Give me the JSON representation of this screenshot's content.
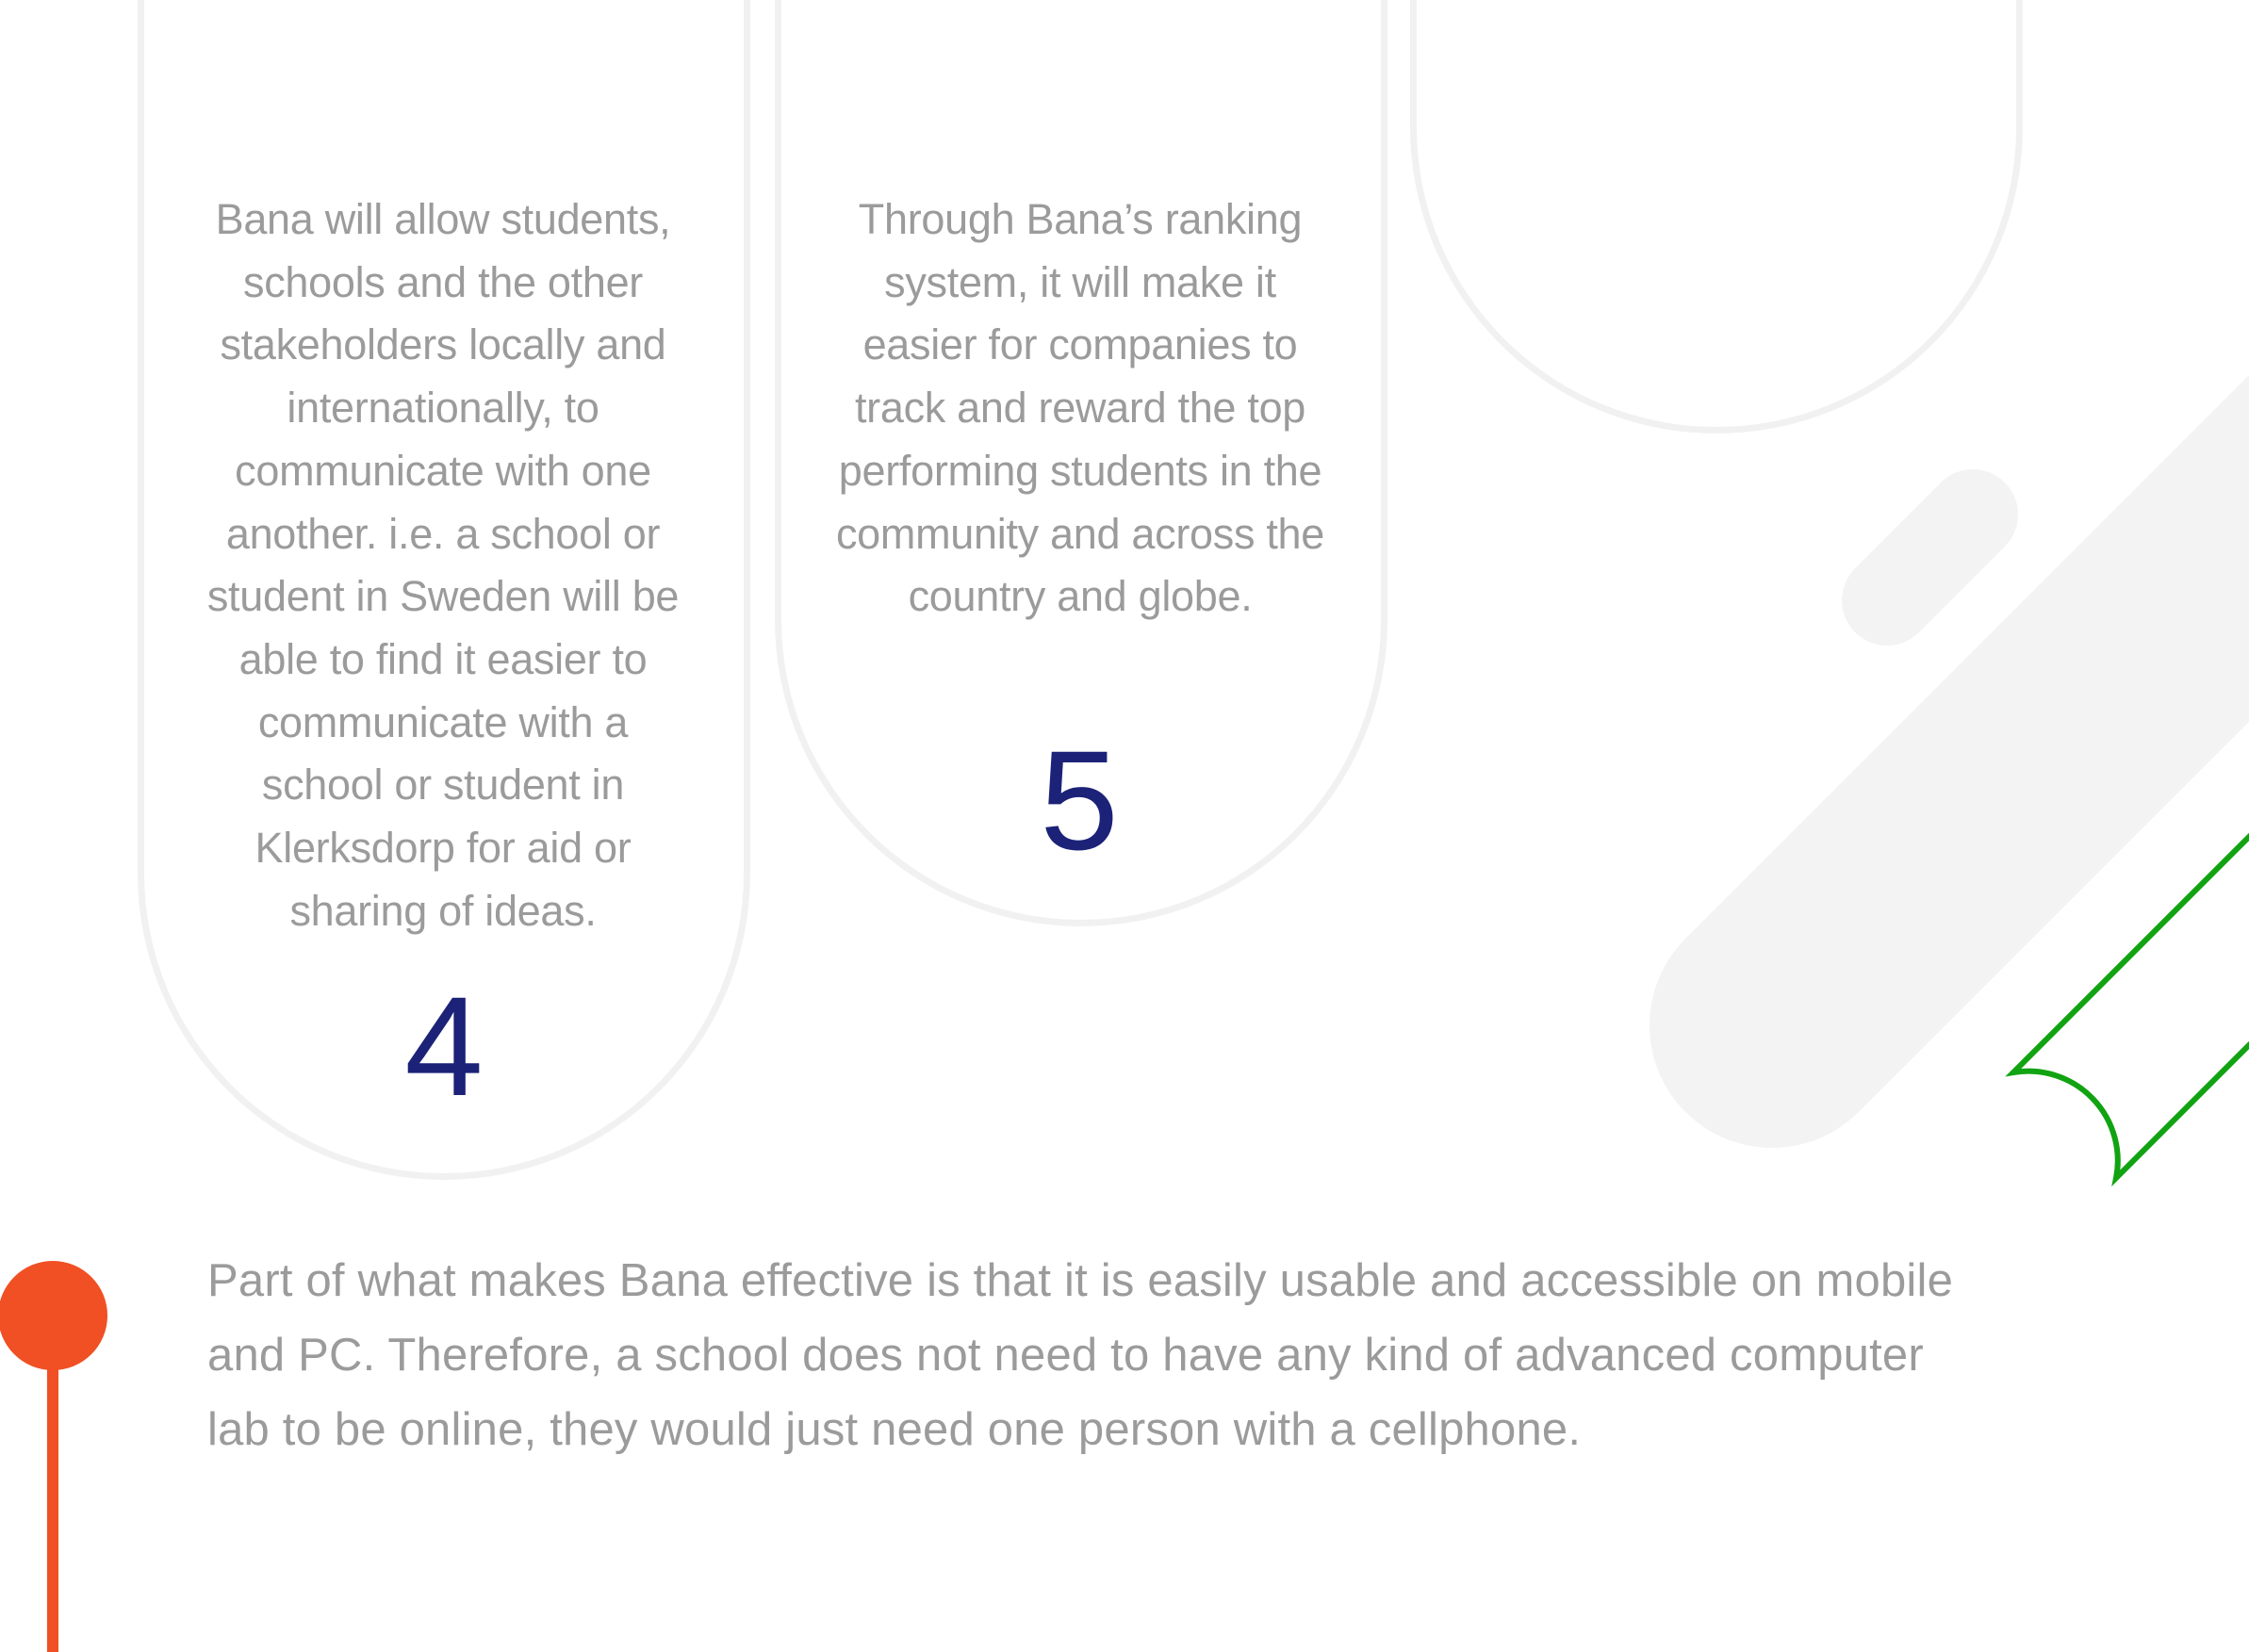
{
  "cards": [
    {
      "text": "Bana will allow students, schools and the other stakeholders locally and internationally, to communicate with one another. i.e. a school or student in Sweden will be able to find it easier to communicate with a school or student in Klerksdorp for aid or sharing of ideas.",
      "number": "4"
    },
    {
      "text": "Through Bana’s ranking system, it will make it easier for companies to track and reward the top performing students in the community and across the country and globe.",
      "number": "5"
    }
  ],
  "paragraph": "Part of what makes Bana effective is that it is easily usable and accessible on mobile and PC. Therefore, a school does not need to have any kind of advanced computer lab to be online, they would just need one person with a cellphone.",
  "colors": {
    "accent_orange": "#f05023",
    "accent_green": "#11a311",
    "number_navy": "#1b2277",
    "text_gray": "#9b9b9b",
    "shape_gray": "#f3f3f3",
    "pill_outline": "#f1f1f1"
  }
}
